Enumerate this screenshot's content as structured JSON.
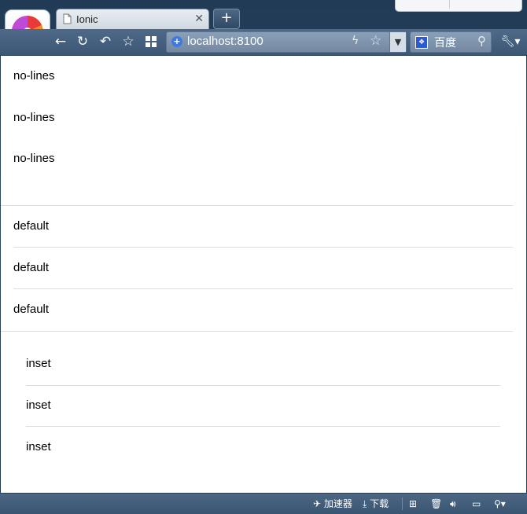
{
  "browser": {
    "tab": {
      "title": "Ionic"
    },
    "address_bar": {
      "url": "localhost:8100"
    },
    "search_box": {
      "engine": "百度"
    },
    "status_bar": {
      "accelerator_label": "加速器",
      "download_label": "下载"
    }
  },
  "page": {
    "lists": [
      {
        "style": "no-lines",
        "items": [
          "no-lines",
          "no-lines",
          "no-lines"
        ]
      },
      {
        "style": "default",
        "items": [
          "default",
          "default",
          "default"
        ]
      },
      {
        "style": "inset",
        "items": [
          "inset",
          "inset",
          "inset"
        ]
      }
    ]
  },
  "colors": {
    "chrome": "#3c5775",
    "page_background": "#ffffff",
    "divider": "#dedede",
    "text": "#000000"
  }
}
